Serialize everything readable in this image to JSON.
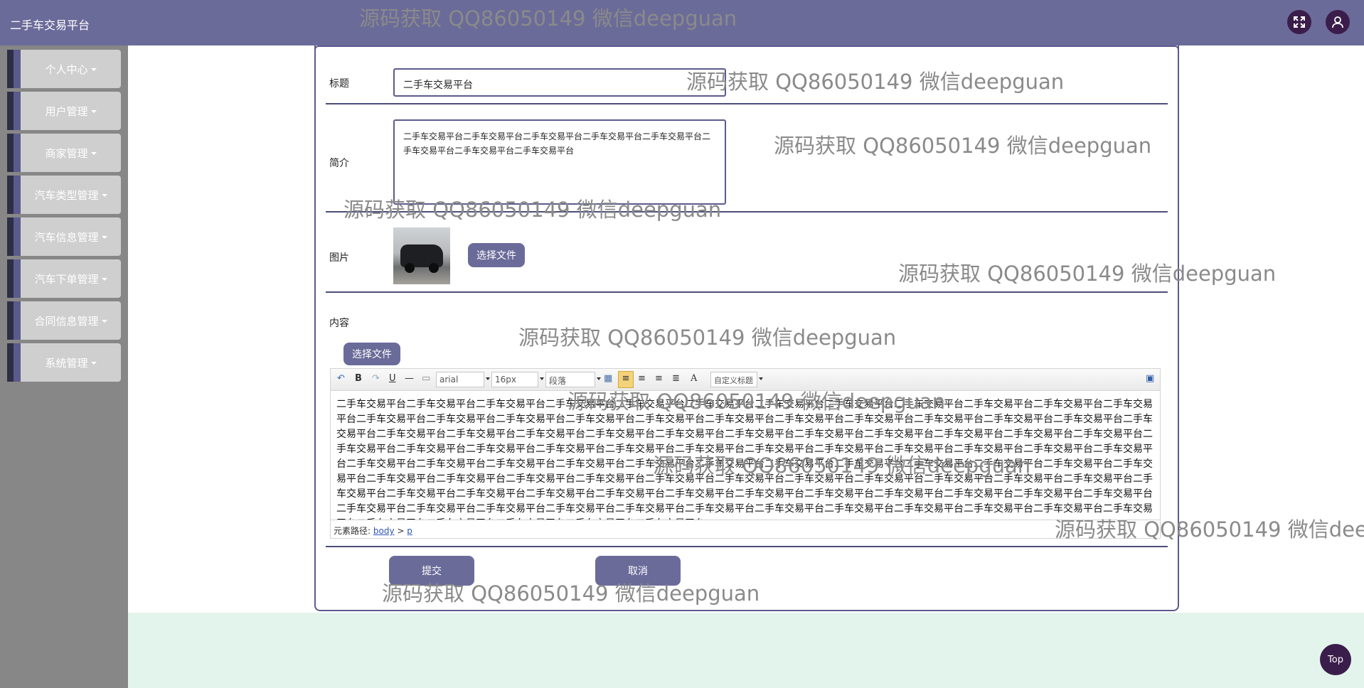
{
  "header": {
    "app_title": "二手车交易平台"
  },
  "sidebar": {
    "items": [
      {
        "label": "个人中心"
      },
      {
        "label": "用户管理"
      },
      {
        "label": "商家管理"
      },
      {
        "label": "汽车类型管理"
      },
      {
        "label": "汽车信息管理"
      },
      {
        "label": "汽车下单管理"
      },
      {
        "label": "合同信息管理"
      },
      {
        "label": "系统管理"
      }
    ]
  },
  "form": {
    "title_label": "标题",
    "title_value": "二手车交易平台",
    "intro_label": "简介",
    "intro_value": "二手车交易平台二手车交易平台二手车交易平台二手车交易平台二手车交易平台二手车交易平台二手车交易平台二手车交易平台",
    "image_label": "图片",
    "choose_file": "选择文件",
    "content_label": "内容",
    "content_choose_file": "选择文件",
    "submit": "提交",
    "cancel": "取消"
  },
  "editor": {
    "font_family": "arial",
    "font_size": "16px",
    "paragraph": "段落",
    "custom_title": "自定义标题",
    "font_color_icon": "A",
    "body_text": "二手车交易平台二手车交易平台二手车交易平台二手车交易平台二手车交易平台二手车交易平台二手车交易平台二手车交易平台二手车交易平台二手车交易平台二手车交易平台二手车交易平台二手车交易平台二手车交易平台二手车交易平台二手车交易平台二手车交易平台二手车交易平台二手车交易平台二手车交易平台二手车交易平台二手车交易平台二手车交易平台二手车交易平台二手车交易平台二手车交易平台二手车交易平台二手车交易平台二手车交易平台二手车交易平台二手车交易平台二手车交易平台二手车交易平台二手车交易平台二手车交易平台二手车交易平台二手车交易平台二手车交易平台二手车交易平台二手车交易平台二手车交易平台二手车交易平台二手车交易平台二手车交易平台二手车交易平台二手车交易平台二手车交易平台二手车交易平台二手车交易平台二手车交易平台二手车交易平台二手车交易平台二手车交易平台二手车交易平台二手车交易平台二手车交易平台二手车交易平台二手车交易平台二手车交易平台二手车交易平台二手车交易平台二手车交易平台二手车交易平台二手车交易平台二手车交易平台二手车交易平台二手车交易平台二手车交易平台二手车交易平台二手车交易平台二手车交易平台二手车交易平台二手车交易平台二手车交易平台二手车交易平台二手车交易平台二手车交易平台二手车交易平台二手车交易平台二手车交易平台二手车交易平台二手车交易平台二手车交易平台二手车交易平台二手车交易平台二手车交易平台二手车交易平台二手车交易平台二手车交易平台二手车交易平台二手车交易平台二手车交易平台二手车交易平台二手车交易平台二手车交易平台二手车交易平台二手车交易平台二手车交易平台二手车交易平台",
    "path_label": "元素路径:",
    "path_body": "body",
    "path_sep": ">",
    "path_p": "p"
  },
  "watermark": "源码获取 QQ86050149 微信deepguan",
  "back_to_top": "Top",
  "colors": {
    "header": "#6b6b9a",
    "sidebar": "#878787",
    "accent": "#5b5b8e",
    "page_bg": "#e3f4ec"
  },
  "icons": [
    "fullscreen-icon",
    "user-icon",
    "undo-icon",
    "bold-icon",
    "redo-icon",
    "underline-icon",
    "horizontal-rule-icon",
    "paste-icon",
    "table-icon",
    "align-left-icon",
    "align-center-icon",
    "align-right-icon",
    "justify-icon",
    "font-color-icon",
    "preview-icon"
  ]
}
